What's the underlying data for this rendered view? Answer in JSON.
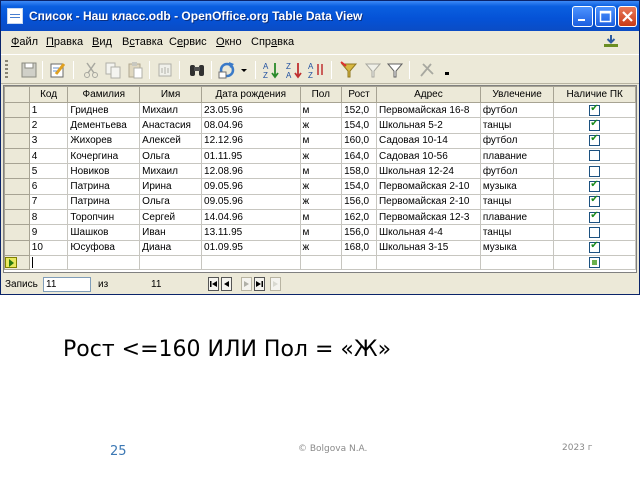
{
  "window": {
    "title": "Список - Наш класс.odb - OpenOffice.org Table Data View"
  },
  "menu": [
    {
      "pre": "",
      "u": "Ф",
      "post": "айл"
    },
    {
      "pre": "",
      "u": "П",
      "post": "равка"
    },
    {
      "pre": "",
      "u": "В",
      "post": "ид"
    },
    {
      "pre": "В",
      "u": "с",
      "post": "тавка"
    },
    {
      "pre": "С",
      "u": "е",
      "post": "рвис"
    },
    {
      "pre": "",
      "u": "О",
      "post": "кно"
    },
    {
      "pre": "Спр",
      "u": "а",
      "post": "вка"
    }
  ],
  "toolbar": {
    "icons": [
      "save-icon",
      "edit-icon",
      "cut-icon",
      "copy-icon",
      "paste-icon",
      "undo-icon",
      "find-icon",
      "refresh-icon",
      "sort-ascending-icon",
      "sort-descending-icon",
      "sort-icon",
      "autofilter-icon",
      "standard-filter-icon",
      "filter-icon",
      "remove-filter-icon"
    ]
  },
  "table": {
    "columns": [
      "Код",
      "Фамилия",
      "Имя",
      "Дата рождения",
      "Пол",
      "Рост",
      "Адрес",
      "Увлечение",
      "Наличие ПК"
    ],
    "rows": [
      {
        "cells": [
          "1",
          "Гриднев",
          "Михаил",
          "23.05.96",
          "м",
          "152,0",
          "Первомайская 16-8",
          "футбол"
        ],
        "pc": true
      },
      {
        "cells": [
          "2",
          "Дементьева",
          "Анастасия",
          "08.04.96",
          "ж",
          "154,0",
          "Школьная 5-2",
          "танцы"
        ],
        "pc": true
      },
      {
        "cells": [
          "3",
          "Жихорев",
          "Алексей",
          "12.12.96",
          "м",
          "160,0",
          "Садовая 10-14",
          "футбол"
        ],
        "pc": true
      },
      {
        "cells": [
          "4",
          "Кочергина",
          "Ольга",
          "01.11.95",
          "ж",
          "164,0",
          "Садовая 10-56",
          "плавание"
        ],
        "pc": false
      },
      {
        "cells": [
          "5",
          "Новиков",
          "Михаил",
          "12.08.96",
          "м",
          "158,0",
          "Школьная 12-24",
          "футбол"
        ],
        "pc": false
      },
      {
        "cells": [
          "6",
          "Патрина",
          "Ирина",
          "09.05.96",
          "ж",
          "154,0",
          "Первомайская 2-10",
          "музыка"
        ],
        "pc": true
      },
      {
        "cells": [
          "7",
          "Патрина",
          "Ольга",
          "09.05.96",
          "ж",
          "156,0",
          "Первомайская 2-10",
          "танцы"
        ],
        "pc": true
      },
      {
        "cells": [
          "8",
          "Торопчин",
          "Сергей",
          "14.04.96",
          "м",
          "162,0",
          "Первомайская 12-3",
          "плавание"
        ],
        "pc": true
      },
      {
        "cells": [
          "9",
          "Шашков",
          "Иван",
          "13.11.95",
          "м",
          "156,0",
          "Школьная 4-4",
          "танцы"
        ],
        "pc": false
      },
      {
        "cells": [
          "10",
          "Юсуфова",
          "Диана",
          "01.09.95",
          "ж",
          "168,0",
          "Школьная 3-15",
          "музыка"
        ],
        "pc": true
      }
    ]
  },
  "recordbar": {
    "label": "Запись",
    "current": "11",
    "of_label": "из",
    "total": "11"
  },
  "slide": {
    "caption": "Рост <=160 ИЛИ Пол = «Ж»",
    "page_number": "25",
    "author": "© Bolgova N.A.",
    "year": "2023 г"
  }
}
